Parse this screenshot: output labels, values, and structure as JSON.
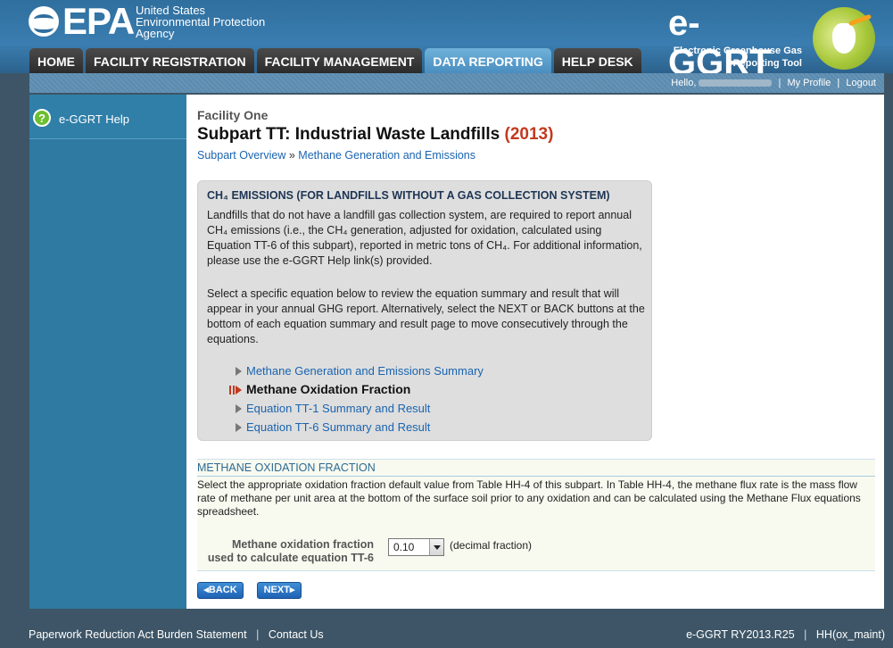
{
  "header": {
    "epa_wordmark": "EPA",
    "epa_agency_line1": "United States",
    "epa_agency_line2": "Environmental Protection",
    "epa_agency_line3": "Agency",
    "app_title": "e-GGRT",
    "app_subtitle_line1": "Electronic Greenhouse Gas",
    "app_subtitle_line2": "Reporting Tool"
  },
  "nav_tabs": [
    {
      "label": "HOME",
      "active": false
    },
    {
      "label": "FACILITY REGISTRATION",
      "active": false
    },
    {
      "label": "FACILITY MANAGEMENT",
      "active": false
    },
    {
      "label": "DATA REPORTING",
      "active": true
    },
    {
      "label": "HELP DESK",
      "active": false
    }
  ],
  "user_bar": {
    "greeting": "Hello,",
    "my_profile": "My Profile",
    "logout": "Logout"
  },
  "sidebar": {
    "help_label": "e-GGRT Help"
  },
  "main": {
    "facility_name": "Facility One",
    "title": "Subpart TT: Industrial Waste Landfills",
    "title_year": "(2013)",
    "breadcrumb": {
      "link1": "Subpart Overview",
      "separator": "»",
      "link2": "Methane Generation and Emissions"
    }
  },
  "info_box": {
    "title": "CH₄ EMISSIONS (FOR LANDFILLS WITHOUT A GAS COLLECTION SYSTEM)",
    "paragraph1": "Landfills that do not have a landfill gas collection system, are required to report annual CH₄ emissions (i.e., the CH₄ generation, adjusted for oxidation, calculated using Equation TT-6 of this subpart), reported in metric tons of CH₄. For additional information, please use the e-GGRT Help link(s) provided.",
    "paragraph2": "Select a specific equation below to review the equation summary and result that will appear in your annual GHG report. Alternatively, select the NEXT or BACK buttons at the bottom of each equation summary and result page to move consecutively through the equations.",
    "steps": [
      {
        "label": "Methane Generation and Emissions Summary",
        "current": false
      },
      {
        "label": "Methane Oxidation Fraction",
        "current": true
      },
      {
        "label": "Equation TT-1 Summary and Result",
        "current": false
      },
      {
        "label": "Equation TT-6 Summary and Result",
        "current": false
      }
    ]
  },
  "form": {
    "section_title": "METHANE OXIDATION FRACTION",
    "description": "Select the appropriate oxidation fraction default value from Table HH-4 of this subpart. In Table HH-4, the methane flux rate is the mass flow rate of methane per unit area at the bottom of the surface soil prior to any oxidation and can be calculated using the Methane Flux equations spreadsheet.",
    "field_label_line1": "Methane oxidation fraction",
    "field_label_line2": "used to calculate equation TT-6",
    "selected_value": "0.10",
    "unit_label": "(decimal fraction)"
  },
  "buttons": {
    "back": "◂BACK",
    "next": "NEXT▸"
  },
  "footer": {
    "paperwork": "Paperwork Reduction Act Burden Statement",
    "contact": "Contact Us",
    "version": "e-GGRT RY2013.R25",
    "server": "HH(ox_maint)"
  },
  "colors": {
    "header_blue": "#3a7db0",
    "sidebar_blue": "#2e7aa2",
    "title_year_red": "#c23a1e",
    "link_blue": "#1a64b0",
    "active_tab": "#4a8ec0"
  }
}
